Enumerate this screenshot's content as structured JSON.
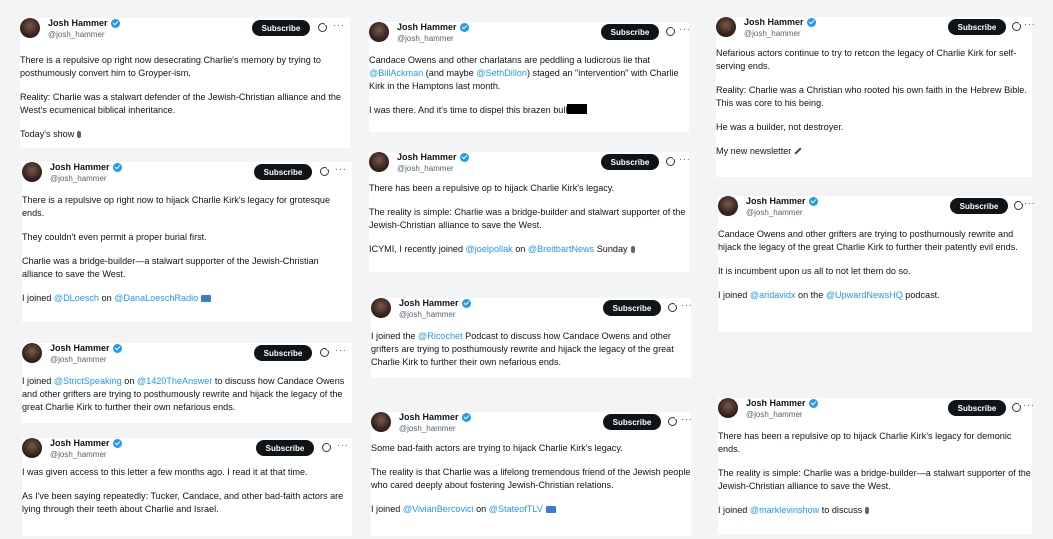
{
  "author": {
    "name": "Josh Hammer",
    "handle": "@josh_hammer"
  },
  "subscribe_label": "Subscribe",
  "more_label": "···",
  "tweets": [
    {
      "paras": [
        "There is a repulsive op right now desecrating Charlie's memory by trying to posthumously convert him to Groyper-ism.",
        "Reality: Charlie was a stalwart defender of the Jewish-Christian alliance and the West's ecumenical biblical inheritance.",
        "Today's show"
      ]
    },
    {
      "paras": [
        "There is a repulsive op right now to hijack Charlie Kirk's legacy for grotesque ends.",
        "They couldn't even permit a proper burial first.",
        "Charlie was a bridge-builder—a stalwart supporter of the Jewish-Christian alliance to save the West.",
        "I joined ",
        "@DLoesch",
        " on ",
        "@DanaLoeschRadio"
      ]
    },
    {
      "paras": [
        "I joined ",
        "@StrictSpeaking",
        " on ",
        "@1420TheAnswer",
        " to discuss how Candace Owens and other grifters are trying to posthumously rewrite and hijack the legacy of the great Charlie Kirk to further their own nefarious ends."
      ]
    },
    {
      "paras": [
        "I was given access to this letter a few months ago. I read it at that time.",
        "As I've been saying repeatedly: Tucker, Candace, and other bad-faith actors are lying through their teeth about Charlie and Israel."
      ]
    },
    {
      "paras": [
        "Candace Owens and other charlatans are peddling a ludicrous lie that ",
        "@BillAckman",
        " (and maybe ",
        "@SethDillon",
        ") staged an \"intervention\" with Charlie Kirk in the Hamptons last month.",
        "I was there. And it's time to dispel this brazen bull"
      ]
    },
    {
      "paras": [
        "There has been a repulsive op to hijack Charlie Kirk's legacy.",
        "The reality is simple: Charlie was a bridge-builder and stalwart supporter of the Jewish-Christian alliance to save the West.",
        "ICYMI, I recently joined ",
        "@joelpollak",
        " on ",
        "@BreitbartNews",
        " Sunday"
      ]
    },
    {
      "paras": [
        "I joined the ",
        "@Ricochet",
        " Podcast to discuss how Candace Owens and other grifters are trying to posthumously rewrite and hijack the legacy of the great Charlie Kirk to further their own nefarious ends."
      ]
    },
    {
      "paras": [
        "Some bad-faith actors are trying to hijack Charlie Kirk's legacy.",
        "The reality is that Charlie was a lifelong tremendous friend of the Jewish people who cared deeply about fostering Jewish-Christian relations.",
        "I joined ",
        "@VivianBercovici",
        " on ",
        "@StateofTLV"
      ]
    },
    {
      "paras": [
        "Nefarious actors continue to try to retcon the legacy of Charlie Kirk for self-serving ends.",
        "Reality: Charlie was a Christian who rooted his own faith in the Hebrew Bible. This was core to his being.",
        "He was a builder, not destroyer.",
        "My new newsletter"
      ]
    },
    {
      "paras": [
        "Candace Owens and other grifters are trying to posthumously rewrite and hijack the legacy of the great Charlie Kirk to further their patently evil ends.",
        "It is incumbent upon us all to not let them do so.",
        "I joined ",
        "@aridavidx",
        " on the ",
        "@UpwardNewsHQ",
        " podcast."
      ]
    },
    {
      "paras": [
        "There has been a repulsive op to hijack Charlie Kirk's legacy for demonic ends.",
        "The reality is simple: Charlie was a bridge-builder—a stalwart supporter of the Jewish-Christian alliance to save the West.",
        "I joined ",
        "@marklevinshow",
        " to discuss"
      ]
    }
  ]
}
